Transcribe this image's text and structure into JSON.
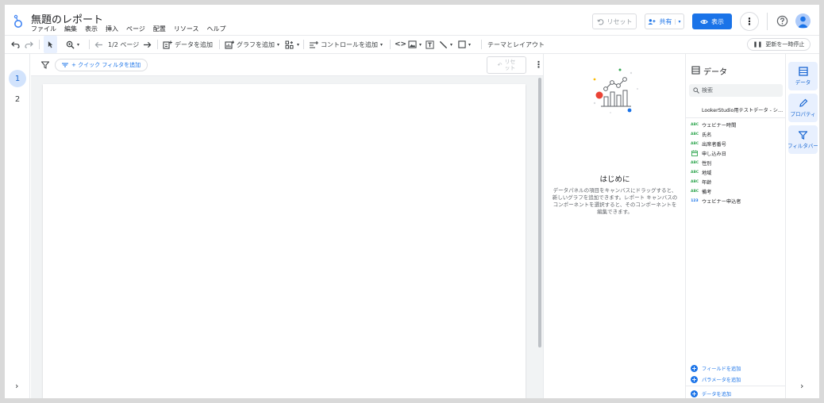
{
  "app": {
    "title": "無題のレポート",
    "menu": [
      "ファイル",
      "編集",
      "表示",
      "挿入",
      "ページ",
      "配置",
      "リソース",
      "ヘルプ"
    ],
    "reset_label": "リセット",
    "share_label": "共有",
    "view_label": "表示",
    "accent": "#1a73e8"
  },
  "toolbar": {
    "page_indicator": "1/2 ページ",
    "add_data": "データを追加",
    "add_chart": "グラフを追加",
    "add_control": "コントロールを追加",
    "theme_layout": "テーマとレイアウト",
    "pause_updates": "更新を一時停止"
  },
  "pages": [
    "1",
    "2"
  ],
  "filterbar": {
    "quick_filter": "+ クイック フィルタを追加",
    "reset_line1": "リセ",
    "reset_line2": "ット"
  },
  "getting_started": {
    "title": "はじめに",
    "description": "データパネルの項目をキャンバスにドラッグすると、新しいグラフを追加できます。レポート キャンバスのコンポーネントを選択すると、そのコンポーネントを編集できます。"
  },
  "data_panel": {
    "title": "データ",
    "search_placeholder": "検索",
    "source": "LookerStudio用テストデータ - シー...",
    "fields": [
      {
        "type": "ABC",
        "name": "ウェビナー時間"
      },
      {
        "type": "ABC",
        "name": "氏名"
      },
      {
        "type": "ABC",
        "name": "出席者番号"
      },
      {
        "type": "date",
        "name": "申し込み日"
      },
      {
        "type": "ABC",
        "name": "性別"
      },
      {
        "type": "ABC",
        "name": "地域"
      },
      {
        "type": "ABC",
        "name": "年齢"
      },
      {
        "type": "ABC",
        "name": "備考"
      },
      {
        "type": "123",
        "name": "ウェビナー申込者"
      }
    ],
    "add_field": "フィールドを追加",
    "add_parameter": "パラメータを追加",
    "add_data": "データを追加"
  },
  "rail": {
    "data": "データ",
    "properties": "プロパティ",
    "filter_bar": "フィルタバー"
  },
  "icons": [
    "logo-icon",
    "undo-icon",
    "redo-icon",
    "pointer-icon",
    "zoom-icon",
    "prev-page-icon",
    "next-page-icon",
    "add-data-icon",
    "add-chart-icon",
    "community-viz-icon",
    "add-control-icon",
    "code-icon",
    "image-icon",
    "text-icon",
    "line-icon",
    "shape-icon",
    "filter-icon",
    "more-vert-icon",
    "help-icon",
    "avatar",
    "search-icon",
    "data-table-icon",
    "pencil-icon",
    "chevron-right-icon"
  ]
}
